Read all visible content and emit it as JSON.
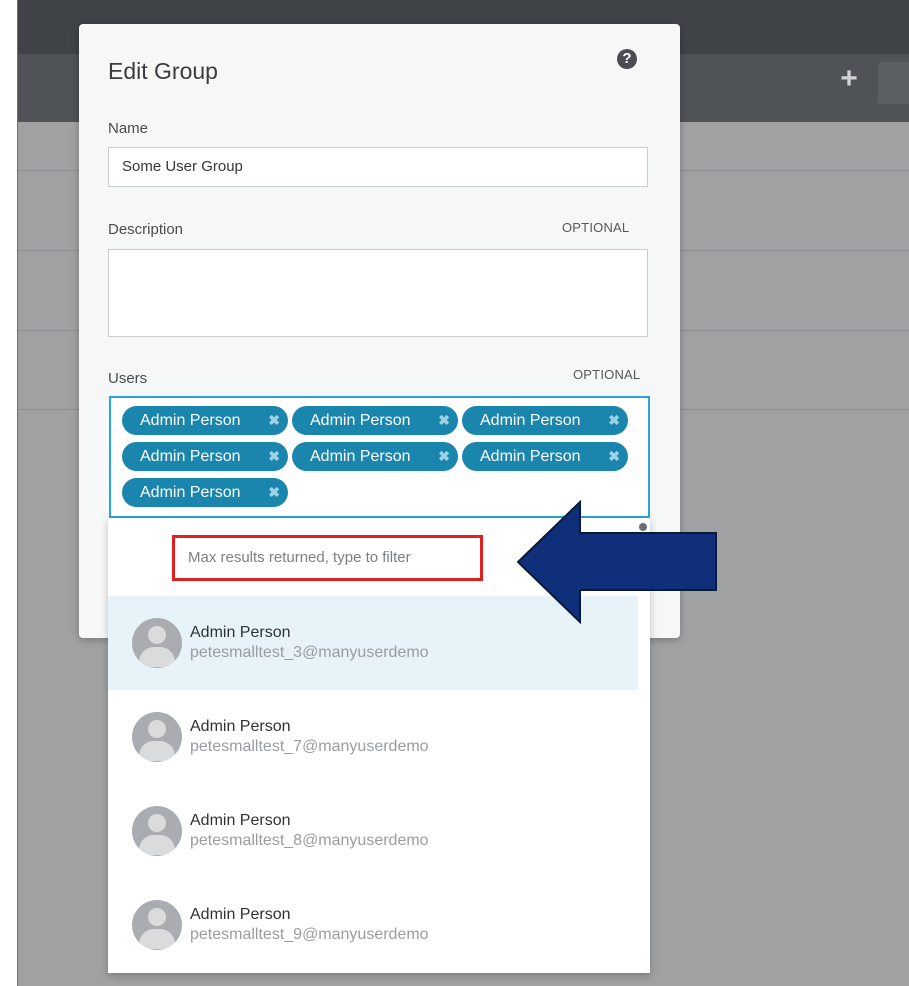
{
  "background": {
    "plus_glyph": "+"
  },
  "modal": {
    "title": "Edit Group",
    "help_glyph": "?",
    "name_label": "Name",
    "name_value": "Some User Group",
    "description_label": "Description",
    "description_optional": "OPTIONAL",
    "description_value": "",
    "users_label": "Users",
    "users_optional": "OPTIONAL"
  },
  "selected_users": [
    {
      "label": "Admin Person",
      "remove_glyph": "✖"
    },
    {
      "label": "Admin Person",
      "remove_glyph": "✖"
    },
    {
      "label": "Admin Person",
      "remove_glyph": "✖"
    },
    {
      "label": "Admin Person",
      "remove_glyph": "✖"
    },
    {
      "label": "Admin Person",
      "remove_glyph": "✖"
    },
    {
      "label": "Admin Person",
      "remove_glyph": "✖"
    },
    {
      "label": "Admin Person",
      "remove_glyph": "✖"
    }
  ],
  "dropdown": {
    "filter_hint": "Max results returned, type to filter",
    "results": [
      {
        "name": "Admin Person",
        "email": "petesmalltest_3@manyuserdemo",
        "highlighted": true
      },
      {
        "name": "Admin Person",
        "email": "petesmalltest_7@manyuserdemo",
        "highlighted": false
      },
      {
        "name": "Admin Person",
        "email": "petesmalltest_8@manyuserdemo",
        "highlighted": false
      },
      {
        "name": "Admin Person",
        "email": "petesmalltest_9@manyuserdemo",
        "highlighted": false
      }
    ]
  },
  "colors": {
    "chip": "#1a86ad",
    "focus_border": "#2aa5d6",
    "callout_box": "#e0201c",
    "arrow_fill": "#0f2f7a",
    "highlight_row": "#e7f2f9"
  },
  "icons": {
    "help": "help-circle-icon",
    "plus": "plus-icon",
    "remove": "remove-x-icon",
    "avatar": "user-avatar-icon",
    "annotation": "left-arrow-icon"
  }
}
